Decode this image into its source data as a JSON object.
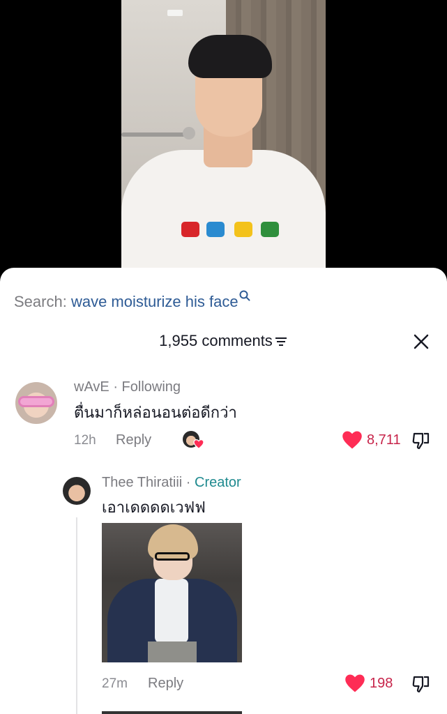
{
  "search": {
    "prefix": "Search:",
    "term": "wave moisturize his face"
  },
  "header": {
    "comment_count": "1,955 comments"
  },
  "comments": [
    {
      "username": "wAvE",
      "relation": " · Following",
      "text": "ตื่นมาก็หล่อนอนต่อดีกว่า",
      "time": "12h",
      "reply_label": "Reply",
      "likes": "8,711",
      "liked": true
    }
  ],
  "replies": [
    {
      "username": "Thee Thiratiii",
      "badge_sep": " · ",
      "badge": "Creator",
      "text": "เอาเดดดดเวฟฟ",
      "time": "27m",
      "reply_label": "Reply",
      "likes": "198",
      "liked": true
    }
  ],
  "colors": {
    "like": "#fe2c55",
    "search_term": "#2e5b95",
    "creator_badge": "#1f8a8f"
  }
}
